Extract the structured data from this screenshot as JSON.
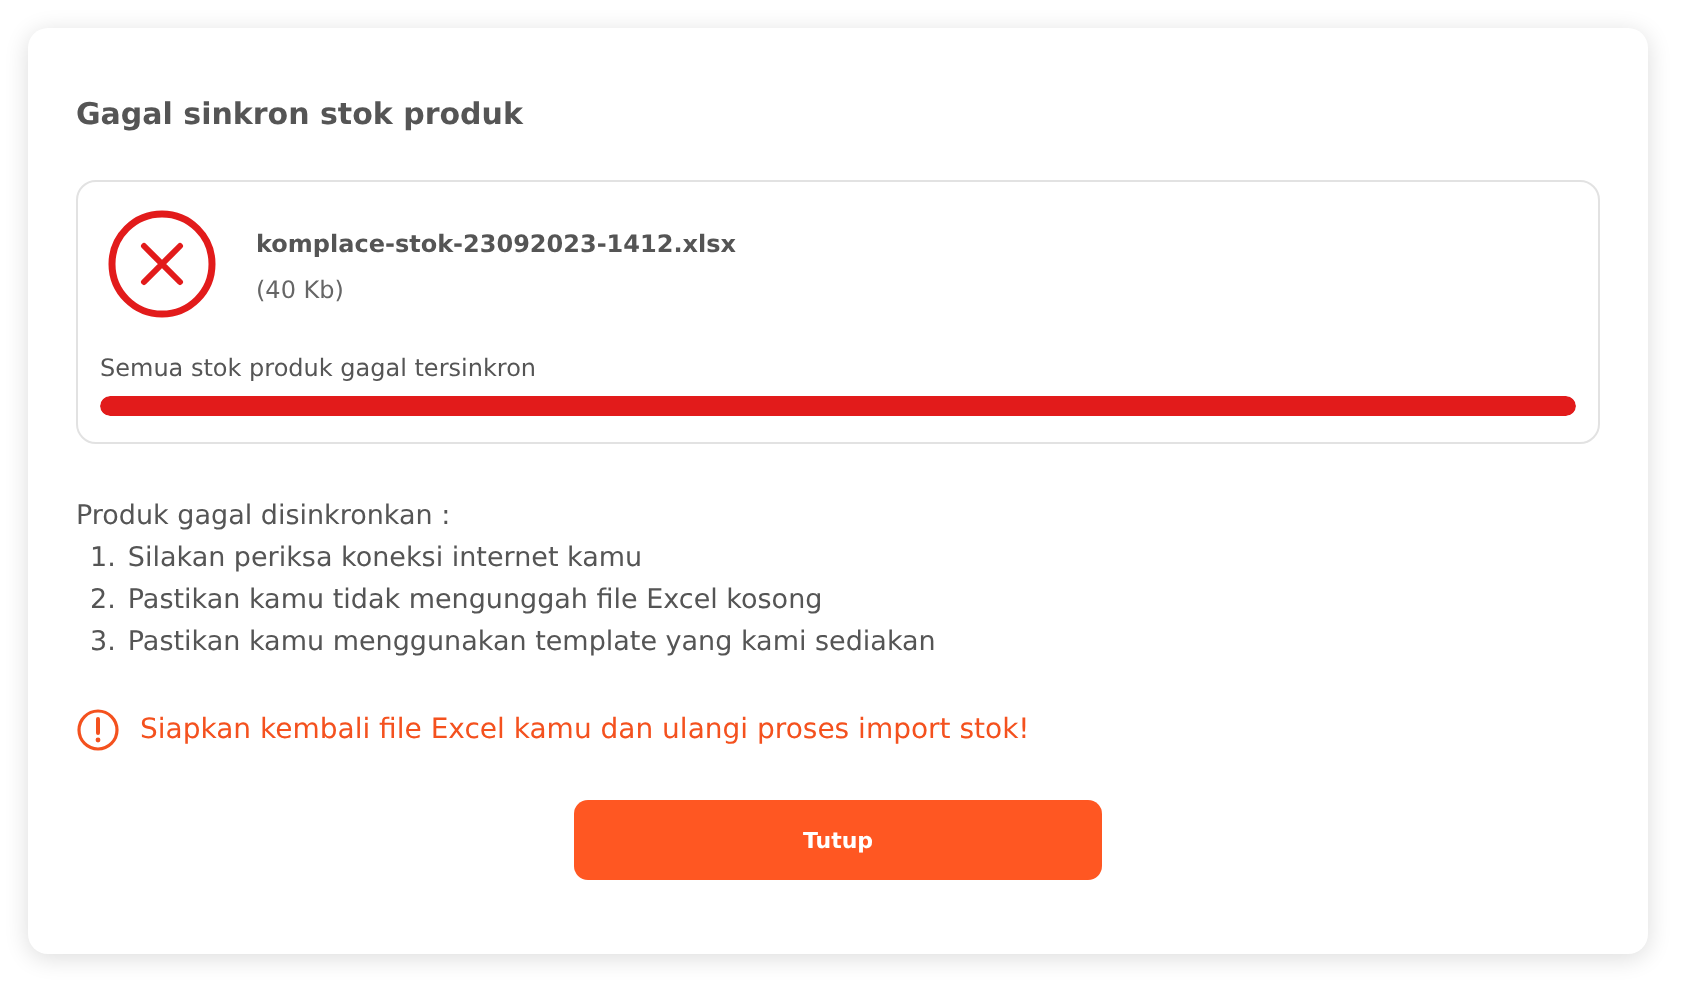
{
  "dialog": {
    "title": "Gagal sinkron stok produk",
    "file": {
      "failed": true,
      "name": "komplace-stok-23092023-1412.xlsx",
      "size": "(40 Kb)",
      "message": "Semua stok produk gagal tersinkron",
      "level": 1
    },
    "reasons": {
      "heading": "Produk gagal disinkronkan :",
      "items": [
        {
          "number": "1.",
          "text": "Silakan periksa koneksi internet kamu"
        },
        {
          "number": "2.",
          "text": "Pastikan kamu tidak mengunggah file Excel kosong"
        },
        {
          "number": "3.",
          "text": "Pastikan kamu menggunakan template yang kami sediakan"
        }
      ]
    },
    "warning": "Siapkan kembali file Excel kamu dan ulangi proses import stok!",
    "button": "Tutup"
  }
}
